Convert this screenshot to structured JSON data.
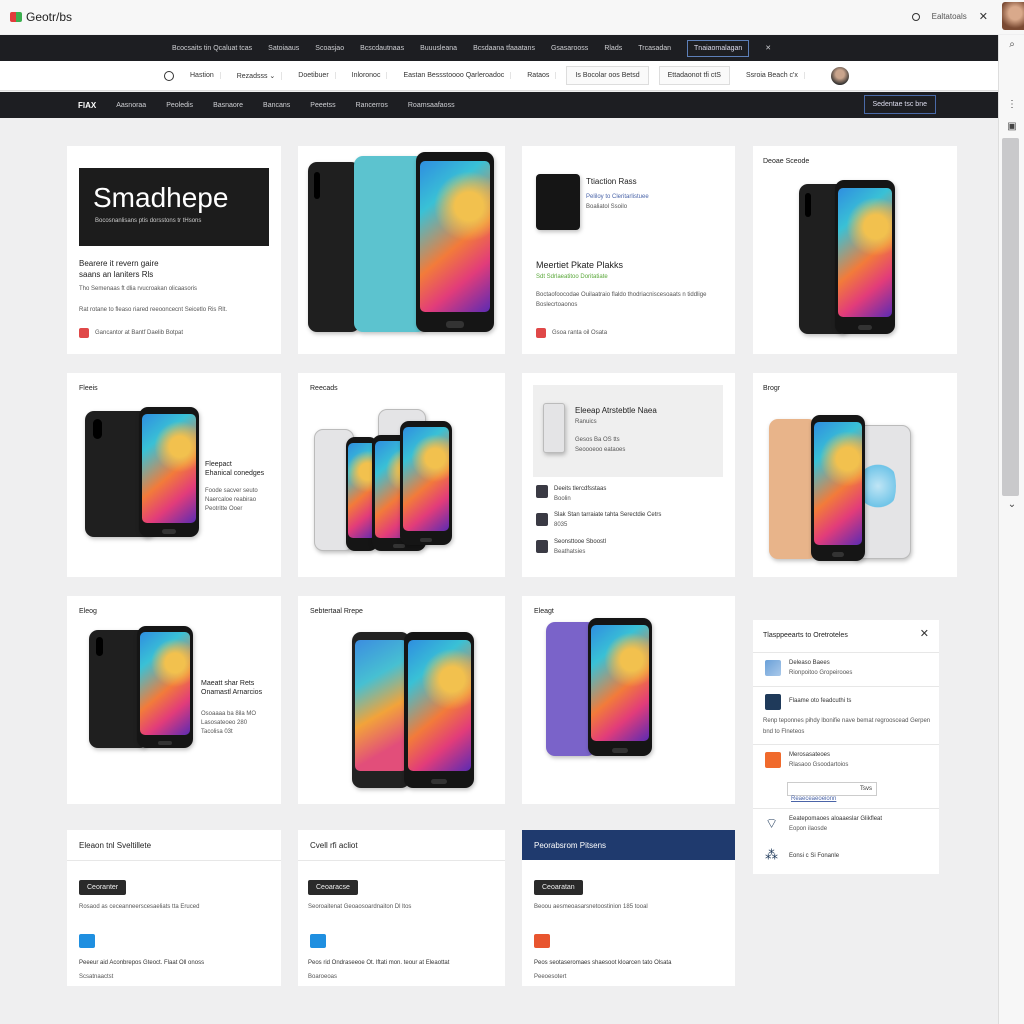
{
  "title_bar": {
    "app_title": "Geotr/bs",
    "link": "Ealtatoals"
  },
  "nav1": {
    "items": [
      "Bcocsaits tin Qcaluat tcas",
      "Satoiaaus",
      "Scoasjao",
      "Bcscdautnaas",
      "Buuusleana",
      "Bcsdaana tfaaatans",
      "Gsasarooss",
      "Rlads",
      "Trcasadan"
    ],
    "boxed": "Tnaiaomalagan"
  },
  "nav2": {
    "items": [
      "Hastion",
      "Rezadsss",
      "Doetibuer",
      "Inloronoc",
      "Eastan Bessstoooo Qarleroadoc",
      "Rataos",
      "Is Bocolar oos Betsd",
      "Ettadaonot tfi ctS",
      "Ssroia Beach c'x"
    ]
  },
  "nav3": {
    "brand": "FlAX",
    "items": [
      "Aasnoraa",
      "Peoledis",
      "Basnaore",
      "Bancans",
      "Peeetss",
      "Rancerros",
      "Roamsaafaoss"
    ],
    "cta": "Sedentae tsc bne"
  },
  "cards": {
    "c1": {
      "hero": "Smadhepe",
      "hero_sub": "Bocosnanlisans ptis dorsstons tr tHsons",
      "heading1": "Bearere it revern gaire",
      "heading2": "saans an laniters Rls",
      "line1": "Tho Semenaas ft dlia rvucroakan olicaasoris",
      "line2": "Rat rotane to fleaso riared reeooncecnt Seicetlo Ris Rlt.",
      "footer": "Gancantor at Bantf Daelib Botpat"
    },
    "c3": {
      "title": "Ttiaction Rass",
      "sub1": "Peliloy to Cleritarlistuee",
      "sub2": "Boaliatol Ssoilo",
      "heading": "Meertiet Pkate Plakks",
      "green": "Sdt Sdrlaeatitoo Doritatiate",
      "body1": "Boctaofoocodae Ouilaatraio flaldo thodriacniscesoaats n tiddlige",
      "body2": "Boslecrtoaonos",
      "footer": "Gsoa ranta oil Osata"
    },
    "c4": {
      "title": "Deoae Sceode"
    },
    "c5": {
      "title": "Fleeis",
      "l1": "Fleepact",
      "l2": "Ehanical conedges",
      "l3": "Foode sacver seuto",
      "l4": "Naercaloe reabirao",
      "l5": "Peotritte Ooer"
    },
    "c6": {
      "title": "Reecads"
    },
    "c7": {
      "box_title": "Eleeap Atrstebtle Naea",
      "box_sub": "Ranuics",
      "box_l1": "Gesos Ba OS tts",
      "box_l2": "Seoooeoo eataoes",
      "r1a": "Deeits tlercdfsstaas",
      "r1b": "Boolin",
      "r2": "Slak Stan tarraiate tahta Serectdie Cetrs",
      "r2b": "8035",
      "r3a": "Seonsttooe Sboostl",
      "r3b": "Beathatsies"
    },
    "c8": {
      "title": "Brogr"
    },
    "c9": {
      "title": "Eleog",
      "l1": "Maeatt shar Rets",
      "l2": "Onamastl Arnarcios",
      "l3": "Osoaaaa ba 8ila MO",
      "l4": "Lasosateoeo 280",
      "l5": "Tacolisa 03t"
    },
    "c10": {
      "title": "Sebtertaal Rrepe"
    },
    "c11": {
      "title": "Eleagt"
    },
    "c13": {
      "title": "Eleaon tnl Sveltillete",
      "button": "Ceoranter",
      "body": "Rosaod as ceceanneerscesaeliats tta Eruced",
      "f1": "Peeeur aid Aconbrepos Gteoct. Flaat Oll onoss",
      "f2": "Scsatnaactst"
    },
    "c14": {
      "title": "Cvell rfi acliot",
      "button": "Ceoaracse",
      "body": "Seoroaitenat Geoaosoardnaiton Dl ltos",
      "f1": "Peos rid Ondraseeoe Ot. lftati mon. teour at Eleaottat",
      "f2": "Boaroeoas"
    },
    "c15": {
      "title": "Peorabsrom Pitsens",
      "button": "Ceoaratan",
      "body": "Beoou aesmeoasarsnetoostinion 185 tooal",
      "f1": "Peos seotaseromaes shaesoot kloarcen tato Olsata",
      "f2": "Peeoesotert"
    }
  },
  "panel": {
    "title": "Tlasppeearts to Oretroteles",
    "r1a": "Deleaso Baees",
    "r1b": "Rionpoitoo Gropeirooes",
    "r2": "Flaame oto feadcuthi ts",
    "r3": "Renp teponnes pihdy lbonifie nave bemat regrooscead Gerpen bnd to Flneteos",
    "r4": "Merosasateoes",
    "r4b": "Rlasaoo Gsoodartoios",
    "r5_input": "Tsvs",
    "r5_link": "Reaeceaeoeionn",
    "r6a": "Eeatepomaoes aloaaeslar Glikfleat",
    "r6b": "Eopon ilaosde",
    "r7": "Eonsi c Si Fonanle"
  }
}
